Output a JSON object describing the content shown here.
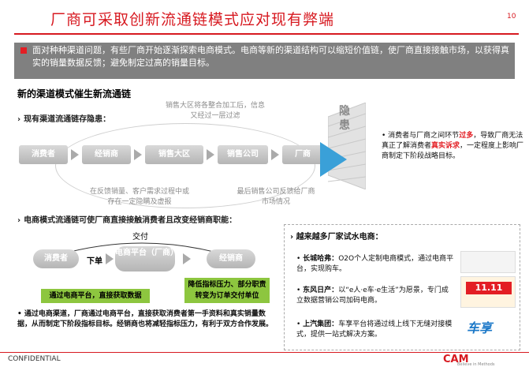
{
  "header": {
    "title": "厂商可采取创新流通链模式应对现有弊端",
    "page_number": "10"
  },
  "intro": "面对种种渠道问题，有些厂商开始逐渐探索电商模式。电商等新的渠道结构可以缩短价值链，使厂商直接接触市场，以获得真实的销量数据反馈；避免制定过高的销量目标。",
  "section_title": "新的渠道模式催生新流通链",
  "current_chain": {
    "subtitle": "现有渠道流通链存隐患：",
    "steps": [
      "消费者",
      "经销商",
      "销售大区",
      "销售公司",
      "厂商"
    ],
    "note_top": "销售大区将各整合加工后，信息又经过一层过滤",
    "note_bottom_left": "在反馈销量、客户需求过程中或存在一定隐瞒及虚报",
    "note_bottom_right": "最后销售公司反馈给厂商市场情况",
    "wall_label": "隐患",
    "warning_pre": "消费者与厂商之间环节",
    "warning_red1": "过多",
    "warning_mid": "，导致厂商无法真正了解消费者",
    "warning_red2": "真实诉求",
    "warning_post": "，一定程度上影响厂商制定下阶段战略目标。"
  },
  "ecommerce": {
    "subtitle": "电商模式流通链可使厂商直接接触消费者且改变经销商职能：",
    "deliver_label": "交付",
    "consumer": "消费者",
    "order_label": "下单",
    "platform": "电商平台（厂商）",
    "dealer": "经销商",
    "green1": "通过电商平台，直接获取数据",
    "green2": "降低指标压力、部分职责转变为订单交付单位",
    "bottom_note": "通过电商渠道，厂商通过电商平台，直接获取消费者第一手资料和真实销量数据，从而制定下阶段指标目标。经销商也将减轻指标压力，有利于双方合作发展。"
  },
  "right_panel": {
    "title": "越来越多厂家试水电商：",
    "items": [
      {
        "brand": "长城哈弗：",
        "text": "O2O个人定制电商模式，通过电商平台，实现购车。"
      },
      {
        "brand": "东风日产：",
        "text": "以“e人·e车·e生活”为愿景，专门成立数据营销公司加码电商。"
      },
      {
        "brand": "上汽集团：",
        "text": "车享平台将通过线上线下无缝对接模式，提供一站式解决方案。"
      }
    ],
    "logo_text": "车享",
    "promo_text": "11.11"
  },
  "footer": {
    "left": "CONFIDENTIAL",
    "logo": "CAM",
    "logo_sub": "Believe in Methods"
  },
  "colors": {
    "accent": "#d71920",
    "grey_box": "#808080",
    "green": "#8dc63f",
    "blue": "#3aa0d8"
  }
}
